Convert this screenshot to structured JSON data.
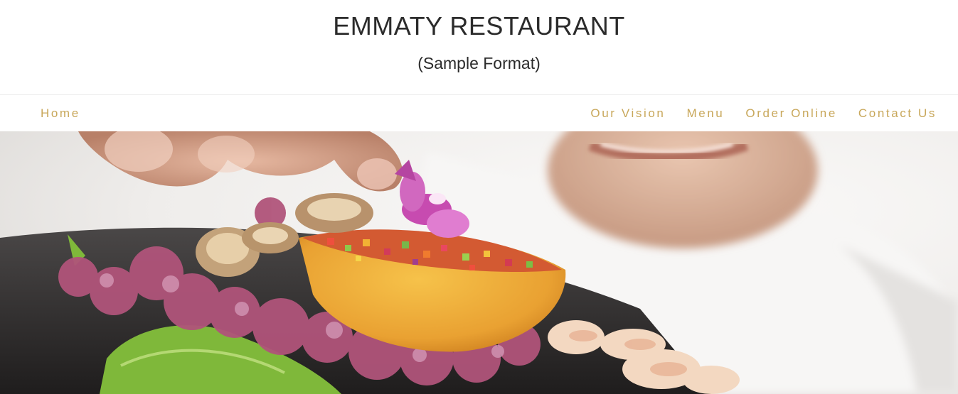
{
  "header": {
    "title": "EMMATY RESTAURANT",
    "subtitle": "(Sample Format)"
  },
  "nav": {
    "home": "Home",
    "items": [
      "Our Vision",
      "Menu",
      "Order Online",
      "Contact Us"
    ]
  },
  "colors": {
    "nav_link": "#c8a75a",
    "title_text": "#2b2b2b"
  },
  "hero": {
    "image_subject": "chef-plating-dish-photo"
  }
}
